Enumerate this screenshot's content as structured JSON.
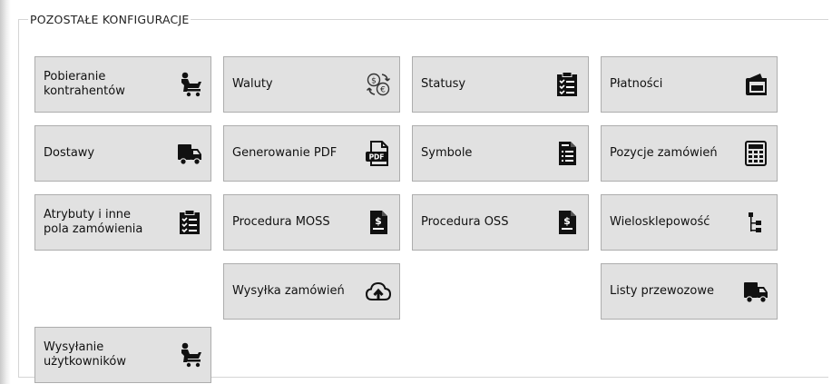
{
  "section": {
    "title": "POZOSTAŁE KONFIGURACJE"
  },
  "buttons": {
    "pobieranie_kontrahentow": "Pobieranie\nkontrahentów",
    "waluty": "Waluty",
    "statusy": "Statusy",
    "platnosci": "Płatności",
    "dostawy": "Dostawy",
    "generowanie_pdf": "Generowanie PDF",
    "symbole": "Symbole",
    "pozycje_zamowien": "Pozycje zamówień",
    "atrybuty": "Atrybuty i inne\npola zamówienia",
    "procedura_moss": "Procedura MOSS",
    "procedura_oss": "Procedura OSS",
    "wielosklepowosc": "Wielosklepowość",
    "wysylka_zamowien": "Wysyłka zamówień",
    "listy_przewozowe": "Listy przewozowe",
    "wysylanie_uzytkownikow": "Wysyłanie\nużytkowników"
  },
  "icons": {
    "pobieranie_kontrahentow": "person-cart-icon",
    "waluty": "currency-exchange-icon",
    "statusy": "clipboard-checklist-icon",
    "platnosci": "wallet-icon",
    "dostawy": "delivery-truck-icon",
    "generowanie_pdf": "pdf-file-icon",
    "symbole": "document-list-icon",
    "pozycje_zamowien": "calculator-icon",
    "atrybuty": "clipboard-checklist-icon",
    "procedura_moss": "dollar-document-icon",
    "procedura_oss": "dollar-document-icon",
    "wielosklepowosc": "hierarchy-icon",
    "wysylka_zamowien": "cloud-upload-icon",
    "listy_przewozowe": "delivery-truck-icon",
    "wysylanie_uzytkownikow": "person-cart-icon"
  },
  "colors": {
    "button_bg": "#e1e1e1",
    "button_border": "#adadad",
    "icon": "#111111"
  }
}
